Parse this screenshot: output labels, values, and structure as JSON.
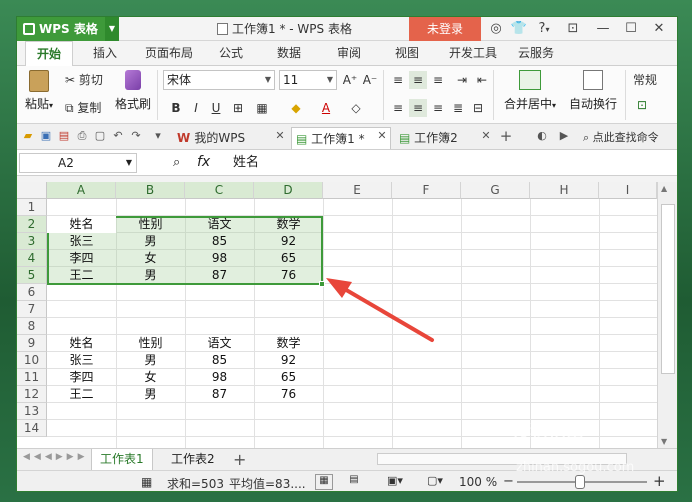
{
  "app": {
    "name": "WPS 表格",
    "doc_title": "工作簿1 * - WPS 表格",
    "login": "未登录",
    "help": "?"
  },
  "ribbon_tabs": [
    "开始",
    "插入",
    "页面布局",
    "公式",
    "数据",
    "审阅",
    "视图",
    "开发工具",
    "云服务"
  ],
  "ribbon": {
    "paste": "粘贴",
    "cut": "剪切",
    "copy": "复制",
    "format_painter": "格式刷",
    "font": "宋体",
    "font_size": "11",
    "bold": "B",
    "italic": "I",
    "underline": "U",
    "merge_center": "合并居中",
    "wrap_text": "自动换行",
    "number_format": "常规"
  },
  "doc_tabs": {
    "mywps": "我的WPS",
    "book1": "工作簿1 *",
    "book2": "工作簿2",
    "search": "点此查找命令"
  },
  "formula_bar": {
    "cell_ref": "A2",
    "fx": "fx",
    "value": "姓名"
  },
  "columns": [
    "A",
    "B",
    "C",
    "D",
    "E",
    "F",
    "G",
    "H",
    "I"
  ],
  "rows": [
    "1",
    "2",
    "3",
    "4",
    "5",
    "6",
    "7",
    "8",
    "9",
    "10",
    "11",
    "12",
    "13",
    "14"
  ],
  "table1": [
    [
      "姓名",
      "性别",
      "语文",
      "数学"
    ],
    [
      "张三",
      "男",
      "85",
      "92"
    ],
    [
      "李四",
      "女",
      "98",
      "65"
    ],
    [
      "王二",
      "男",
      "87",
      "76"
    ]
  ],
  "table2": [
    [
      "姓名",
      "性别",
      "语文",
      "数学"
    ],
    [
      "张三",
      "男",
      "85",
      "92"
    ],
    [
      "李四",
      "女",
      "98",
      "65"
    ],
    [
      "王二",
      "男",
      "87",
      "76"
    ]
  ],
  "sheets": [
    "工作表1",
    "工作表2"
  ],
  "add_sheet": "+",
  "status": {
    "sum": "求和=503",
    "avg": "平均值=83....",
    "zoom": "100 %"
  },
  "watermark": {
    "brand": "搜狗指南",
    "url": "zhinan.sogou.com"
  }
}
